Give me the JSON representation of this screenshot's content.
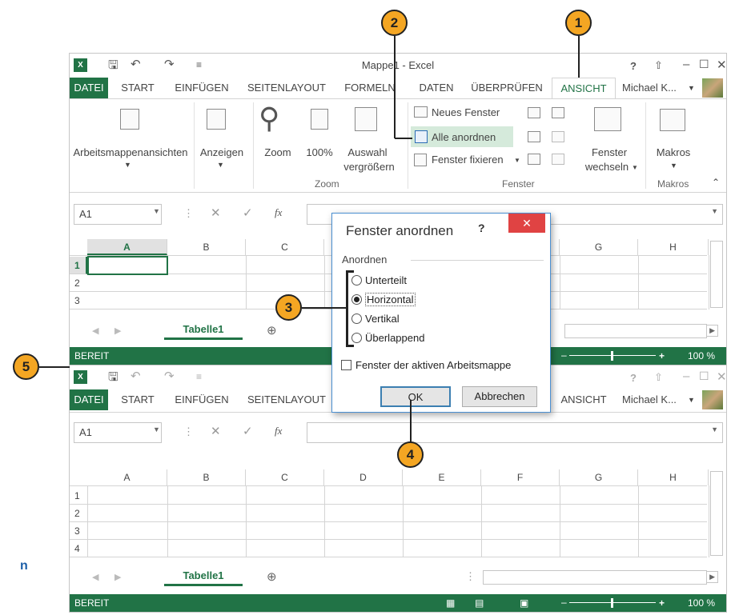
{
  "window1": {
    "title": "Mappe1 - Excel",
    "tabs": [
      "DATEI",
      "START",
      "EINFÜGEN",
      "SEITENLAYOUT",
      "FORMELN",
      "DATEN",
      "ÜBERPRÜFEN",
      "ANSICHT"
    ],
    "user": "Michael K...",
    "help": "?",
    "ribbon": {
      "arbeitsmappenansichten": "Arbeitsmappenansichten",
      "anzeigen": "Anzeigen",
      "zoom": "Zoom",
      "zoom100": "100%",
      "auswahl1": "Auswahl",
      "auswahl2": "vergrößern",
      "neues_fenster": "Neues Fenster",
      "alle_anordnen": "Alle anordnen",
      "fenster_fixieren": "Fenster fixieren",
      "fenster_wechseln1": "Fenster",
      "fenster_wechseln2": "wechseln",
      "makros": "Makros",
      "group_zoom": "Zoom",
      "group_fenster": "Fenster",
      "group_makros": "Makros"
    },
    "namebox": "A1",
    "columns": [
      "A",
      "B",
      "C",
      "D",
      "E",
      "F",
      "G",
      "H"
    ],
    "rows": [
      "1",
      "2",
      "3"
    ],
    "sheet_tab": "Tabelle1",
    "status": "BEREIT",
    "zoom_percent": "100 %"
  },
  "window2": {
    "title": "Mappe1 - Excel",
    "tabs": [
      "DATEI",
      "START",
      "EINFÜGEN",
      "SEITENLAYOUT",
      "ANSICHT"
    ],
    "user": "Michael K...",
    "help": "?",
    "namebox": "A1",
    "columns": [
      "A",
      "B",
      "C",
      "D",
      "E",
      "F",
      "G",
      "H"
    ],
    "rows": [
      "1",
      "2",
      "3",
      "4"
    ],
    "sheet_tab": "Tabelle1",
    "status": "BEREIT",
    "zoom_percent": "100 %"
  },
  "dialog": {
    "title": "Fenster anordnen",
    "help": "?",
    "group_label": "Anordnen",
    "options": [
      {
        "label": "Unterteilt",
        "selected": false
      },
      {
        "label": "Horizontal",
        "selected": true
      },
      {
        "label": "Vertikal",
        "selected": false
      },
      {
        "label": "Überlappend",
        "selected": false
      }
    ],
    "checkbox_label": "Fenster der aktiven Arbeitsmappe",
    "ok": "OK",
    "cancel": "Abbrechen"
  },
  "callouts": [
    "1",
    "2",
    "3",
    "4",
    "5"
  ],
  "side_text": "n",
  "icons": [
    "excel-logo-icon",
    "save-icon",
    "undo-icon",
    "redo-icon",
    "minimize-icon",
    "maximize-icon",
    "close-icon",
    "zoom-icon",
    "plus-icon"
  ]
}
